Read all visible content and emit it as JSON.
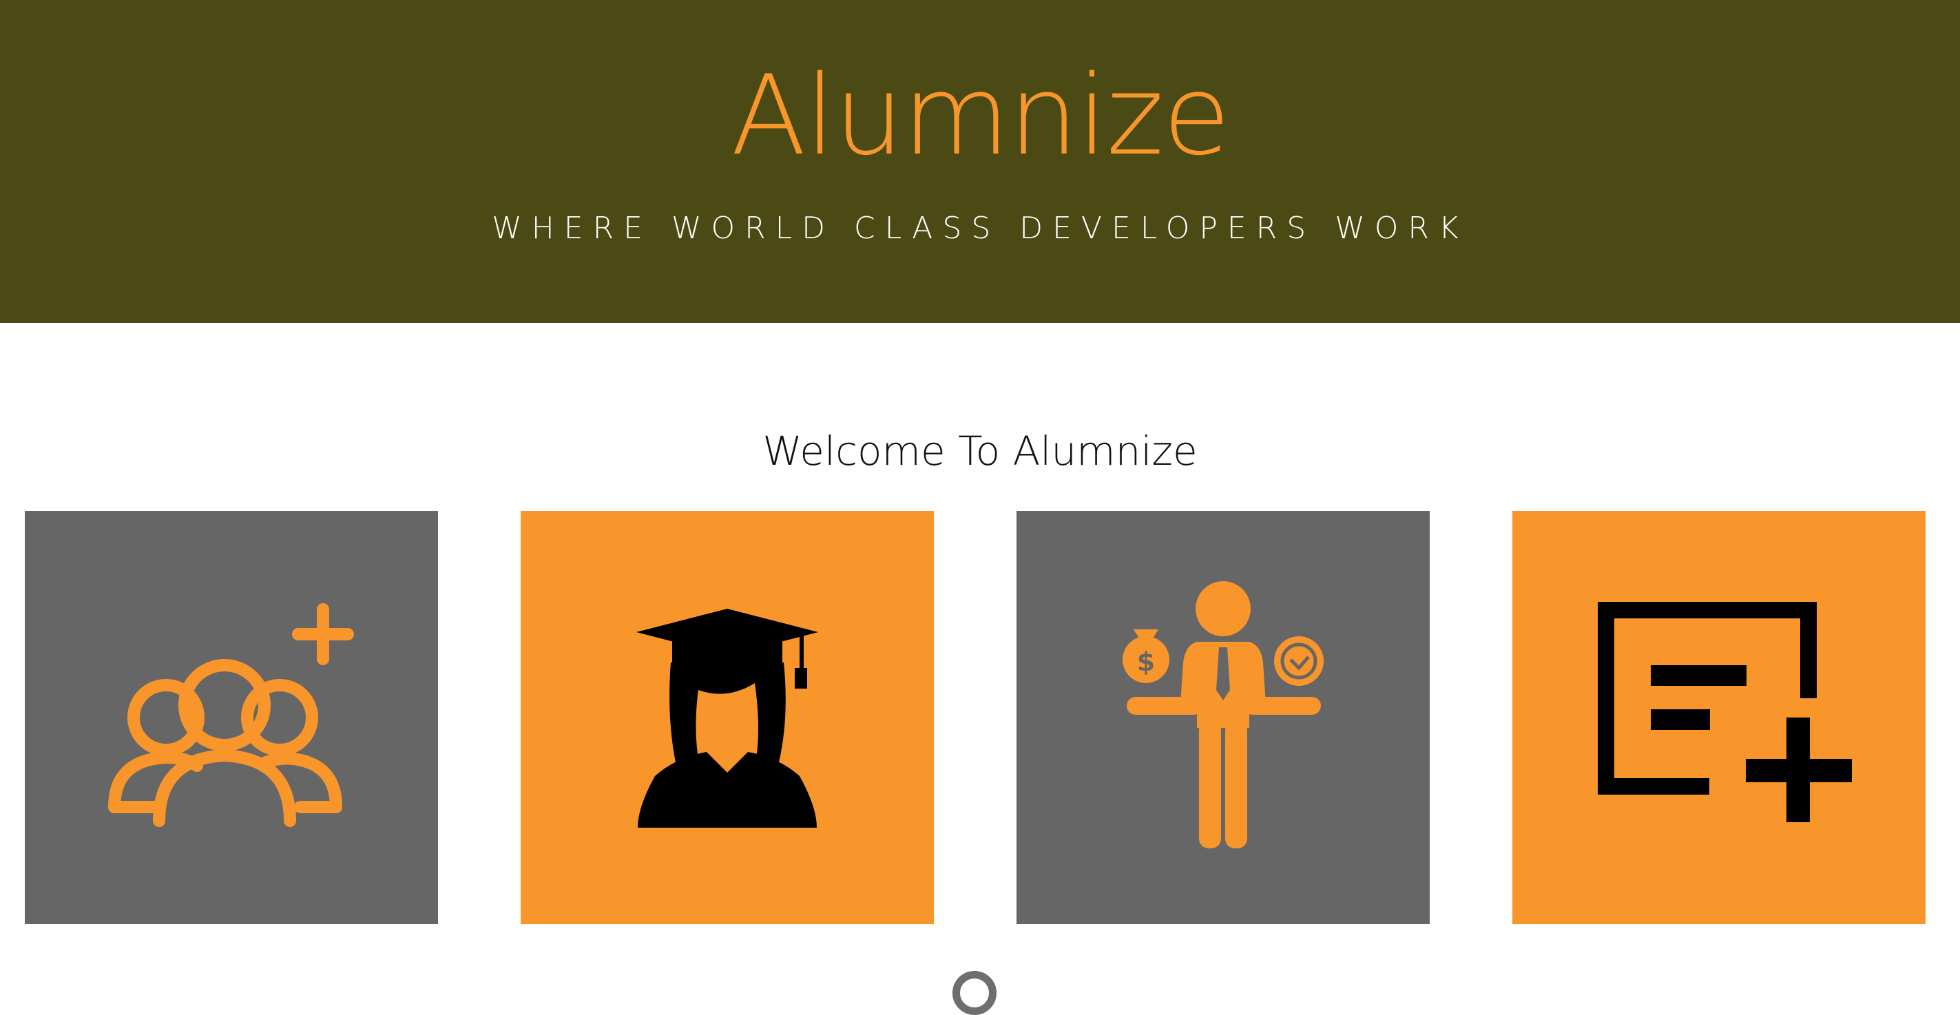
{
  "header": {
    "brand": "Alumnize",
    "tagline": "WHERE WORLD CLASS DEVELOPERS WORK"
  },
  "main": {
    "welcome": "Welcome To Alumnize",
    "tiles": [
      {
        "icon": "add-group-icon",
        "color": "#666666",
        "icon_color": "#f9962b"
      },
      {
        "icon": "graduate-icon",
        "color": "#f9962b",
        "icon_color": "#000000"
      },
      {
        "icon": "businessman-money-time-icon",
        "color": "#666666",
        "icon_color": "#f9962b"
      },
      {
        "icon": "add-post-icon",
        "color": "#f9962b",
        "icon_color": "#000000"
      }
    ]
  },
  "colors": {
    "header_bg": "#4b4a14",
    "accent": "#f9962b",
    "tile_gray": "#666666"
  }
}
